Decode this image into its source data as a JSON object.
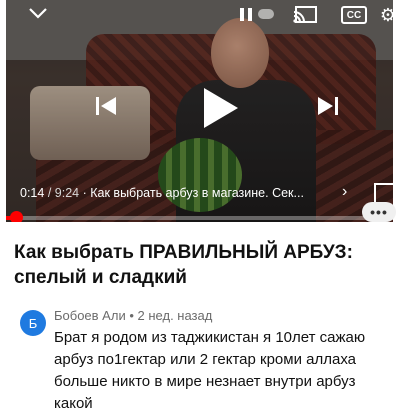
{
  "player": {
    "current_time": "0:14",
    "duration": "9:24",
    "separator": "/",
    "chapter": "· Как выбрать арбуз в магазине. Сек...",
    "chevron": "›",
    "progress_fraction": 0.025,
    "cc_label": "CC",
    "icons": {
      "collapse": "chevron-down-icon",
      "pause": "pause-icon",
      "cast": "cast-icon",
      "captions": "captions-icon",
      "settings": "settings-icon",
      "previous": "previous-icon",
      "play": "play-icon",
      "next": "next-icon",
      "fullscreen": "fullscreen-icon"
    },
    "progress_color": "#ff0000",
    "more_label": "•••"
  },
  "video": {
    "title": "Как выбрать ПРАВИЛЬНЫЙ АРБУЗ: спелый и сладкий"
  },
  "comment": {
    "avatar_letter": "Б",
    "author": "Бобоев Али",
    "time": "2 нед. назад",
    "meta_separator": "•",
    "text": "Брат я родом из таджикистан я 10лет сажаю арбуз по1гектар или 2 гектар кроми аллаха больше никто в мире незнает внутри арбуз какой",
    "avatar_color": "#1f7ae0"
  }
}
